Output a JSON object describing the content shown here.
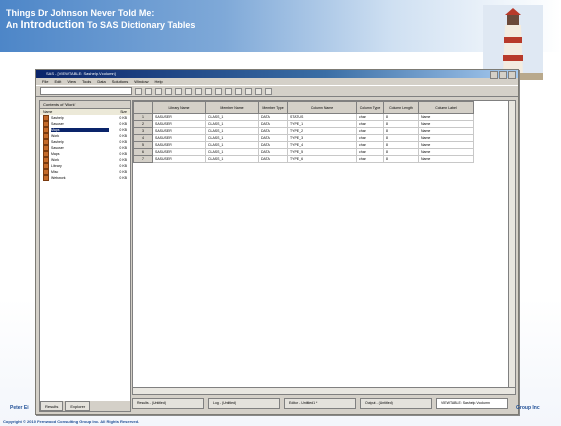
{
  "slide": {
    "title_line1": "Things Dr Johnson Never Told Me:",
    "title_line2_prefix": "An ",
    "title_line2_emph": "Introduction",
    "title_line2_rest": " To SAS Dictionary Tables",
    "footer_left": "Peter Ei",
    "footer_right": "Group Inc",
    "copyright": "Copyright © 2010 Fernwood Consulting Group Inc. All Rights Reserved."
  },
  "window": {
    "title": "SAS - [VIEWTABLE: Sashelp.Vcolumn]",
    "menus": [
      "File",
      "Edit",
      "View",
      "Tools",
      "Data",
      "Solutions",
      "Window",
      "Help"
    ],
    "left_pane_title": "Contents of 'Work'",
    "lib_columns": [
      "Name",
      "Size"
    ],
    "libraries": [
      {
        "name": "Sashelp",
        "size": "0 KB"
      },
      {
        "name": "Sasuser",
        "size": "0 KB"
      },
      {
        "name": "Maps",
        "size": "0 KB"
      },
      {
        "name": "Work",
        "size": "0 KB"
      },
      {
        "name": "Sashelp",
        "size": "0 KB"
      },
      {
        "name": "Sasuser",
        "size": "0 KB"
      },
      {
        "name": "Maps",
        "size": "0 KB"
      },
      {
        "name": "Work",
        "size": "0 KB"
      },
      {
        "name": "Library",
        "size": "0 KB"
      },
      {
        "name": "Misc",
        "size": "0 KB"
      },
      {
        "name": "Webwork",
        "size": "0 KB"
      }
    ],
    "left_tabs": [
      "Results",
      "Explorer"
    ],
    "grid_columns": [
      "",
      "Library Name",
      "Member Name",
      "Member Type",
      "Column Name",
      "Column Type",
      "Column Length",
      "Column Label"
    ],
    "grid_rows": [
      [
        "1",
        "SASUSER",
        "CLASS_1",
        "DATA",
        "STATUS",
        "char",
        "8",
        "Name"
      ],
      [
        "2",
        "SASUSER",
        "CLASS_1",
        "DATA",
        "TYPE_1",
        "char",
        "8",
        "Name"
      ],
      [
        "3",
        "SASUSER",
        "CLASS_1",
        "DATA",
        "TYPE_2",
        "char",
        "8",
        "Name"
      ],
      [
        "4",
        "SASUSER",
        "CLASS_1",
        "DATA",
        "TYPE_3",
        "char",
        "8",
        "Name"
      ],
      [
        "5",
        "SASUSER",
        "CLASS_1",
        "DATA",
        "TYPE_4",
        "char",
        "8",
        "Name"
      ],
      [
        "6",
        "SASUSER",
        "CLASS_1",
        "DATA",
        "TYPE_5",
        "char",
        "8",
        "Name"
      ],
      [
        "7",
        "SASUSER",
        "CLASS_1",
        "DATA",
        "TYPE_6",
        "char",
        "8",
        "Name"
      ]
    ],
    "taskbar": [
      "Results - (Untitled)",
      "Log - (Untitled)",
      "Editor - Untitled1 *",
      "Output - (Untitled)",
      "VIEWTABLE: Sashelp.Vcolumn"
    ]
  }
}
